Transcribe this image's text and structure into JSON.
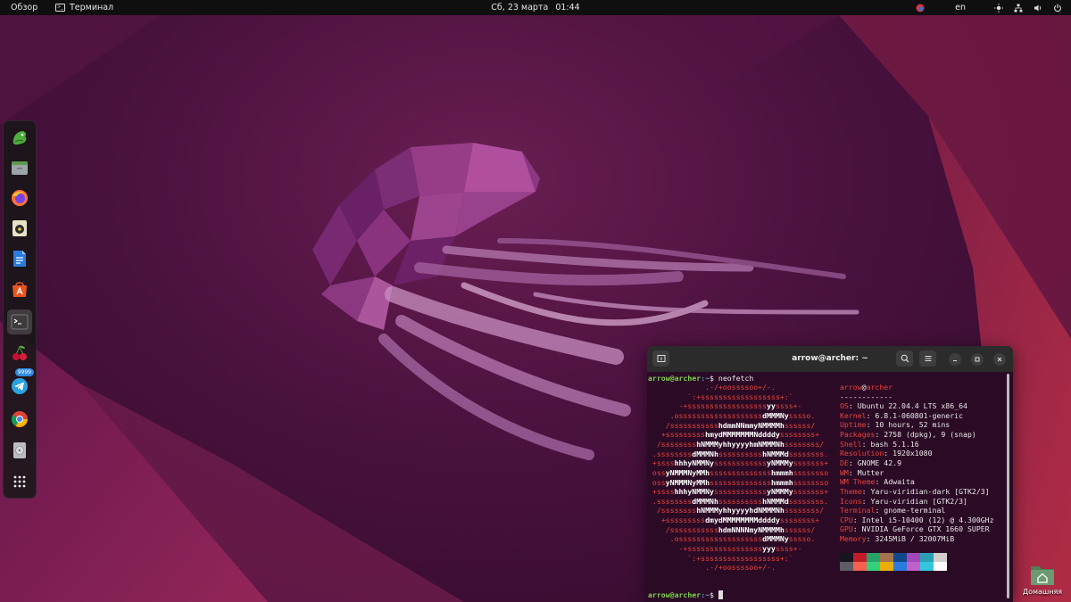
{
  "topbar": {
    "overview": "Обзор",
    "app_name": "Терминал",
    "date": "Сб, 23 марта",
    "time": "01:44",
    "keyboard_layout": "en"
  },
  "dock": {
    "items": [
      {
        "name": "Snapcraft",
        "icon": "dragon-icon"
      },
      {
        "name": "Files",
        "icon": "files-icon"
      },
      {
        "name": "Firefox",
        "icon": "firefox-icon"
      },
      {
        "name": "Rhythmbox",
        "icon": "rhythmbox-icon"
      },
      {
        "name": "LibreOffice Writer",
        "icon": "writer-icon"
      },
      {
        "name": "Ubuntu Software",
        "icon": "software-icon"
      },
      {
        "name": "Terminal",
        "icon": "terminal-icon"
      },
      {
        "name": "Cherry",
        "icon": "cherry-icon"
      },
      {
        "name": "Telegram",
        "icon": "telegram-icon",
        "badge": "9999"
      },
      {
        "name": "Chrome",
        "icon": "chrome-icon"
      },
      {
        "name": "Disk",
        "icon": "disk-icon"
      },
      {
        "name": "Show Applications",
        "icon": "app-grid-icon"
      }
    ]
  },
  "terminal": {
    "title": "arrow@archer: ~",
    "prompt_user": "arrow@archer",
    "prompt_path": ":~",
    "prompt_symbol": "$",
    "command": "neofetch",
    "logo_lines": [
      "             .-/+oossssoo+/-.",
      "         `:+ssssssssssssssssss+:`",
      "       -+ssssssssssssssssssyyssss+-",
      "     .osssssssssssssssssssdMMMNysssso.",
      "    /ssssssssssshdmmNNmmyNMMMMhssssss/",
      "   +ssssssssshmydMMMMMMMNddddyssssssss+",
      "  /sssssssshNMMMyhhyyyyhmNMMMNhssssssss/",
      " .ssssssssdMMMNhsssssssssshNMMMdssssssss.",
      " +sssshhhyNMMNyssssssssssssyNMMMysssssss+",
      " ossyNMMMNyMMhsssssssssssssshmmmhssssssso",
      " ossyNMMMNyMMhsssssssssssssshmmmhssssssso",
      " +sssshhhyNMMNyssssssssssssyNMMMysssssss+",
      " .ssssssssdMMMNhsssssssssshNMMMdssssssss.",
      "  /sssssssshNMMMyhhyyyyhdNMMMNhssssssss/",
      "   +sssssssssdmydMMMMMMMMddddyssssssss+",
      "    /ssssssssssshdmNNNNmyNMMMMhssssss/",
      "     .osssssssssssssssssssdMMMNysssso.",
      "       -+sssssssssssssssssyyyssss+-",
      "         `:+ssssssssssssssssss+:`",
      "             .-/+oossssoo+/-."
    ],
    "info_header_user": "arrow",
    "info_header_at": "@",
    "info_header_host": "archer",
    "info_separator": "------------",
    "info": [
      {
        "key": "OS",
        "value": "Ubuntu 22.04.4 LTS x86_64"
      },
      {
        "key": "Kernel",
        "value": "6.8.1-060801-generic"
      },
      {
        "key": "Uptime",
        "value": "10 hours, 52 mins"
      },
      {
        "key": "Packages",
        "value": "2758 (dpkg), 9 (snap)"
      },
      {
        "key": "Shell",
        "value": "bash 5.1.16"
      },
      {
        "key": "Resolution",
        "value": "1920x1080"
      },
      {
        "key": "DE",
        "value": "GNOME 42.9"
      },
      {
        "key": "WM",
        "value": "Mutter"
      },
      {
        "key": "WM Theme",
        "value": "Adwaita"
      },
      {
        "key": "Theme",
        "value": "Yaru-viridian-dark [GTK2/3]"
      },
      {
        "key": "Icons",
        "value": "Yaru-viridian [GTK2/3]"
      },
      {
        "key": "Terminal",
        "value": "gnome-terminal"
      },
      {
        "key": "CPU",
        "value": "Intel i5-10400 (12) @ 4.300GHz"
      },
      {
        "key": "GPU",
        "value": "NVIDIA GeForce GTX 1660 SUPER"
      },
      {
        "key": "Memory",
        "value": "3245MiB / 32007MiB"
      }
    ],
    "palette_top": [
      "#171421",
      "#c01c28",
      "#26a269",
      "#a2734c",
      "#12488b",
      "#a347ba",
      "#2aa1b3",
      "#d0cfcc"
    ],
    "palette_bottom": [
      "#5e5c64",
      "#f66151",
      "#33d17a",
      "#e9ad0c",
      "#2a7bde",
      "#c061cb",
      "#33c7de",
      "#ffffff"
    ]
  },
  "desktop": {
    "home_label": "Домашняя"
  }
}
